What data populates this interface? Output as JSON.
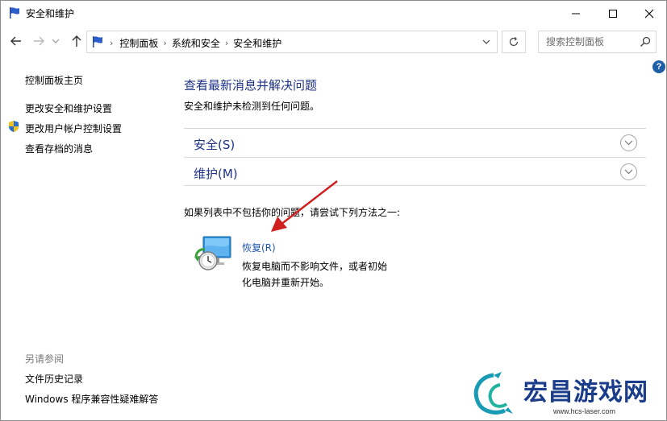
{
  "window": {
    "title": "安全和维护",
    "controls": [
      "minimize",
      "maximize",
      "close"
    ]
  },
  "nav": {
    "breadcrumbs": [
      "控制面板",
      "系统和安全",
      "安全和维护"
    ],
    "search_placeholder": "搜索控制面板"
  },
  "left_pane": {
    "home": "控制面板主页",
    "links": [
      "更改安全和维护设置",
      "更改用户帐户控制设置",
      "查看存档的消息"
    ],
    "see_also_title": "另请参阅",
    "see_also": [
      "文件历史记录",
      "Windows 程序兼容性疑难解答"
    ]
  },
  "main": {
    "heading": "查看最新消息并解决问题",
    "subtext": "安全和维护未检测到任何问题。",
    "sections": [
      {
        "label": "安全(S)"
      },
      {
        "label": "维护(M)"
      }
    ],
    "try_text": "如果列表中不包括你的问题，请尝试下列方法之一:",
    "recovery": {
      "link": "恢复(R)",
      "description": "恢复电脑而不影响文件，或者初始化电脑并重新开始。"
    }
  },
  "watermark": {
    "title": "宏昌游戏网",
    "url": "www.hcs-laser.com"
  },
  "colors": {
    "heading_blue": "#1e3287",
    "link_blue": "#1e56b0",
    "annotation_red": "#d01f1f"
  },
  "icons": {
    "title": "flag-icon",
    "shield": "uac-shield-icon",
    "recovery": "recovery-icon"
  }
}
